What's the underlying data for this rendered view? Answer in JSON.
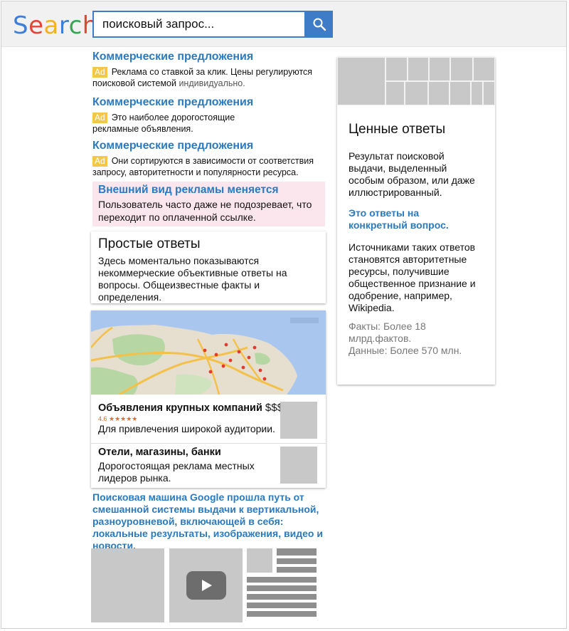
{
  "header": {
    "logo_letters": [
      "S",
      "e",
      "a",
      "r",
      "c",
      "h"
    ],
    "search_query": "поисковый запрос..."
  },
  "ads": [
    {
      "title": "Коммерческие предложения",
      "badge": "Ad",
      "text_line1": "Реклама со ставкой за клик. Цены регулируются",
      "text_line2_dark": "поисковой системой",
      "text_line2_gray": " индивидуально."
    },
    {
      "title": "Коммерческие предложения",
      "badge": "Ad",
      "text_line1": "Это наиболее дорогостоящие",
      "text_line2": "рекламные объявления."
    },
    {
      "title": "Коммерческие предложения",
      "badge": "Ad",
      "text_line1": "Они сортируются в зависимости от соответствия",
      "text_line2": "запросу, авторитетности и популярности ресурса."
    }
  ],
  "pink": {
    "title": "Внешний вид рекламы меняется",
    "text_line1": "Пользователь часто даже не подозревает, что",
    "text_line2": "переходит по оплаченной ссылке."
  },
  "simple_answers": {
    "title": "Простые ответы",
    "text_lines": [
      "Здесь моментально показываются",
      "некоммерческие объективные ответы на",
      "вопросы. Общеизвестные факты и",
      "определения."
    ]
  },
  "local": {
    "biz1": {
      "title": "Объявления крупных компаний",
      "price": "$$$",
      "rating": "4.6 ★★★★★",
      "text": "Для привлечения широкой аудитории."
    },
    "biz2": {
      "title": "Отели, магазины, банки",
      "text_line1": "Дорогостоящая реклама местных",
      "text_line2": "лидеров рынка."
    }
  },
  "caption_lines": [
    "Поисковая машина Google прошла путь от",
    "смешанной системы выдачи к вертикальной,",
    "разноуровневой, включающей в себя:",
    "локальные результаты, изображения, видео и",
    "новости."
  ],
  "sidebar": {
    "title": "Ценные ответы",
    "para1": [
      "Результат поисковой",
      "выдачи, выделенный",
      "особым образом, или даже",
      "иллюстрированный."
    ],
    "blue": [
      "Это ответы на",
      "конкретный вопрос."
    ],
    "para2": [
      "Источниками таких ответов",
      "становятся авторитетные",
      "ресурсы, получившие",
      "общественное признание и",
      "одобрение, например,",
      "Wikipedia."
    ],
    "gray": [
      "Факты: Более 18",
      "млрд.фактов.",
      "Данные: Более 570 млн."
    ]
  },
  "icons": {
    "search": "search-icon",
    "play": "play-icon"
  },
  "colors": {
    "accent_blue": "#2a7ac0",
    "search_border": "#3e7cc7",
    "ad_badge": "#f6c648",
    "pink_bg": "#fbe6ee",
    "placeholder_gray": "#c8c8c8"
  }
}
